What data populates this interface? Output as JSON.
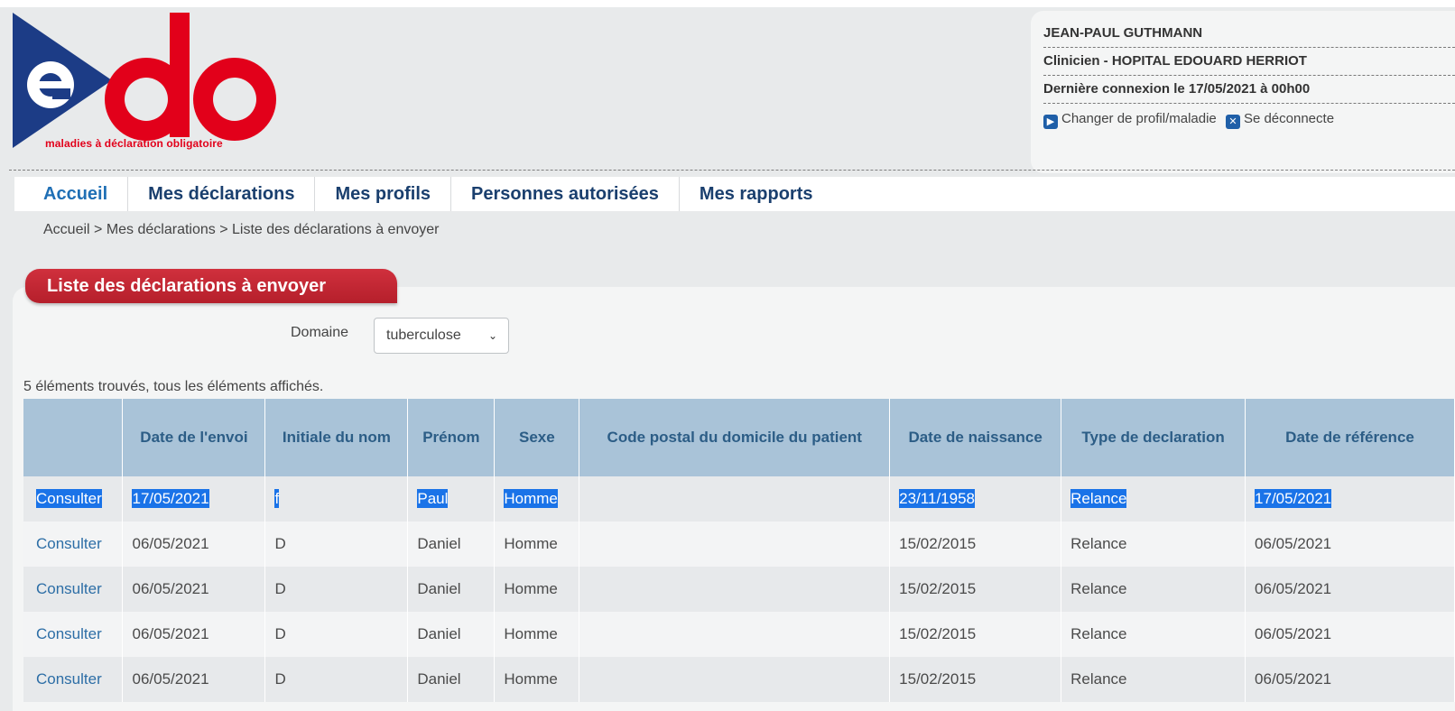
{
  "logo": {
    "tagline": "maladies à déclaration obligatoire",
    "colors": {
      "triangle": "#1c3c86",
      "letters": "#e2001a"
    }
  },
  "user": {
    "name": "JEAN-PAUL GUTHMANN",
    "role": "Clinicien - HOPITAL EDOUARD HERRIOT",
    "last_login": "Dernière connexion le 17/05/2021 à 00h00",
    "change_profile": "Changer de profil/maladie",
    "logout": "Se déconnecte"
  },
  "nav": {
    "items": [
      "Accueil",
      "Mes déclarations",
      "Mes profils",
      "Personnes autorisées",
      "Mes rapports"
    ],
    "active": "Accueil"
  },
  "breadcrumb": "Accueil > Mes déclarations > Liste des déclarations à envoyer",
  "section_title": "Liste des déclarations à envoyer",
  "filter": {
    "label": "Domaine",
    "value": "tuberculose"
  },
  "results_count": "5 éléments trouvés, tous les éléments affichés.",
  "table": {
    "headers": [
      "",
      "Date de l'envoi",
      "Initiale du nom",
      "Prénom",
      "Sexe",
      "Code postal du domicile du patient",
      "Date de naissance",
      "Type de declaration",
      "Date de référence"
    ],
    "rows": [
      [
        "Consulter",
        "17/05/2021",
        "f",
        "Paul",
        "Homme",
        "",
        "23/11/1958",
        "Relance",
        "17/05/2021"
      ],
      [
        "Consulter",
        "06/05/2021",
        "D",
        "Daniel",
        "Homme",
        "",
        "15/02/2015",
        "Relance",
        "06/05/2021"
      ],
      [
        "Consulter",
        "06/05/2021",
        "D",
        "Daniel",
        "Homme",
        "",
        "15/02/2015",
        "Relance",
        "06/05/2021"
      ],
      [
        "Consulter",
        "06/05/2021",
        "D",
        "Daniel",
        "Homme",
        "",
        "15/02/2015",
        "Relance",
        "06/05/2021"
      ],
      [
        "Consulter",
        "06/05/2021",
        "D",
        "Daniel",
        "Homme",
        "",
        "15/02/2015",
        "Relance",
        "06/05/2021"
      ]
    ],
    "selected_row": 0
  }
}
